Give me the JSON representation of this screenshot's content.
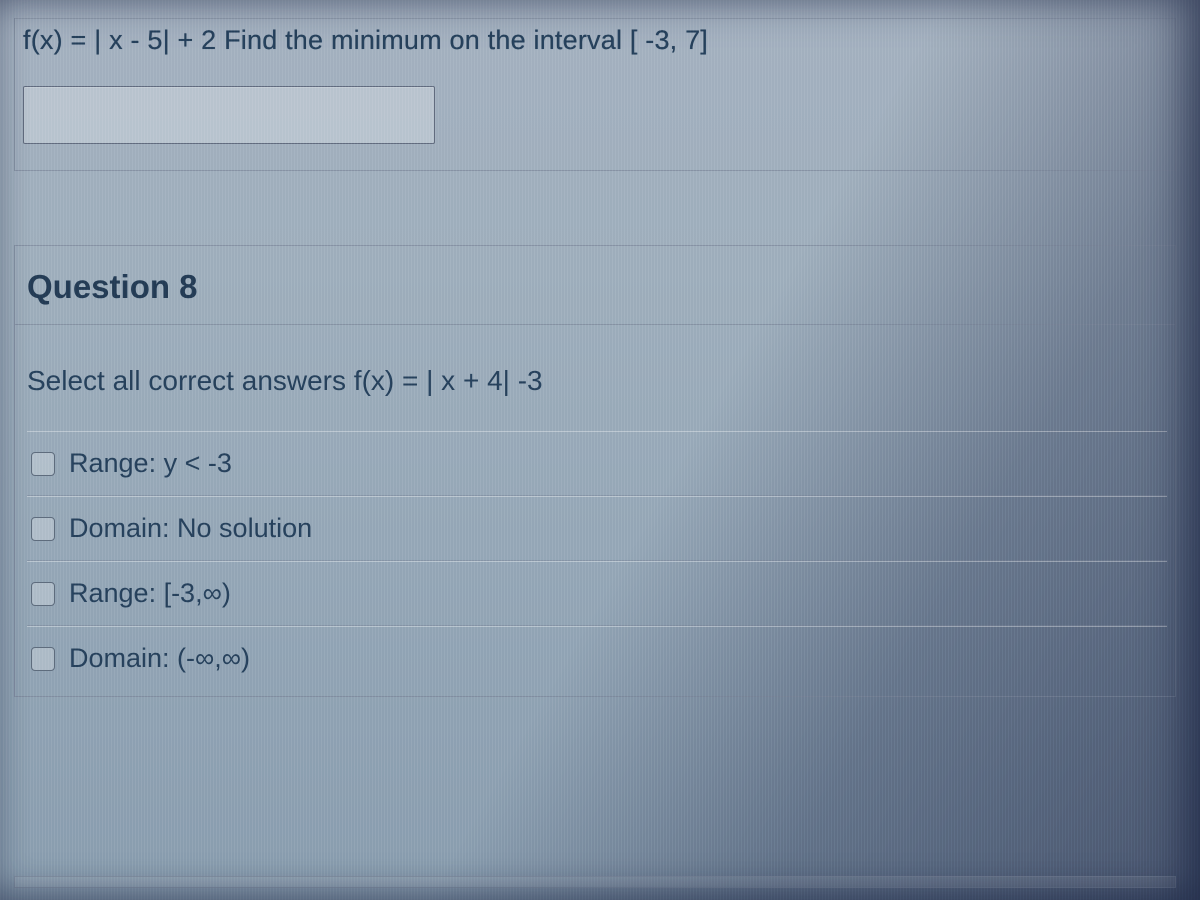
{
  "question7": {
    "prompt": "f(x) = | x - 5| + 2   Find the minimum on the interval  [ -3, 7]",
    "answer_value": ""
  },
  "question8": {
    "title": "Question 8",
    "prompt": "Select all correct answers   f(x) = | x + 4| -3",
    "options": [
      {
        "label": "Range: y < -3"
      },
      {
        "label": "Domain: No solution"
      },
      {
        "label": "Range: [-3,∞)"
      },
      {
        "label": "Domain: (-∞,∞)"
      }
    ]
  }
}
